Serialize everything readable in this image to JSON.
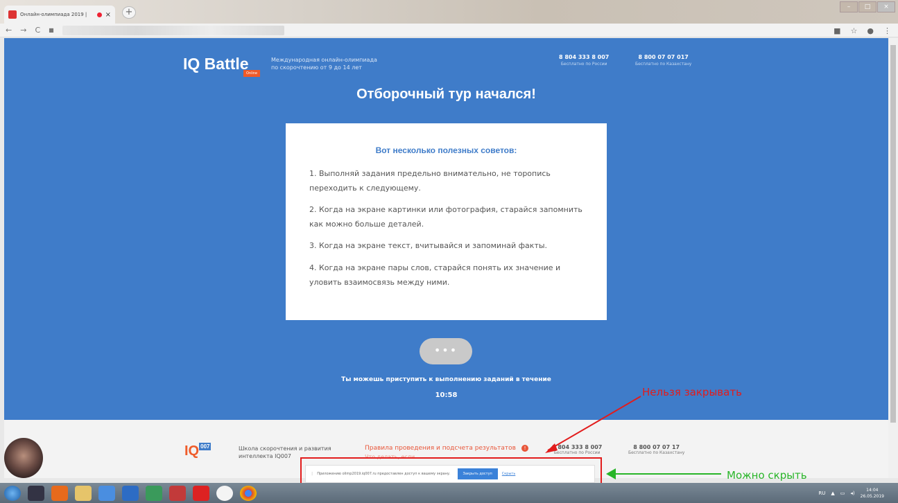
{
  "browser": {
    "tab_title": "Онлайн-олимпиада 2019 |",
    "new_tab": "+",
    "tab_close": "×",
    "back": "←",
    "forward": "→",
    "reload": "C",
    "lock": "🔒"
  },
  "header": {
    "logo": "IQ Battle",
    "logo_badge": "Online",
    "tagline_line1": "Международная онлайн-олимпиада",
    "tagline_line2": "по скорочтению от 9 до 14 лет",
    "phone1": "8 804 333 8 007",
    "phone1_sub": "Бесплатно по России",
    "phone2": "8 800 07 07 017",
    "phone2_sub": "Бесплатно по Казахстану"
  },
  "headline": "Отборочный тур начался!",
  "card": {
    "title": "Вот несколько полезных советов:",
    "tips": [
      "1. Выполняй задания предельно внимательно, не торопись переходить к следующему.",
      "2. Когда на экране картинки или фотография, старайся запомнить как можно больше деталей.",
      "3. Когда на экране текст, вчитывайся и запоминай факты.",
      "4. Когда на экране пары слов, старайся понять их значение и уловить взаимосвязь между ними."
    ]
  },
  "dots_button": "•••",
  "timer_text": "Ты можешь приступить к выполнению заданий в течение",
  "timer": "10:58",
  "footer": {
    "logo": "IQ",
    "logo_badge": "007",
    "school_line1": "Школа скорочтения и развития",
    "school_line2": "интеллекта IQ007",
    "rules": "Правила проведения и подсчета результатов",
    "what_to_do": "Что делать, если",
    "phone1": "8 804 333 8 007",
    "phone1_sub": "Бесплатно по России",
    "phone2": "8 800 07 07 17",
    "phone2_sub": "Бесплатно по Казахстану"
  },
  "sharebar": {
    "text": "Приложению olimp2019.iq007.ru предоставлен доступ к вашему экрану.",
    "stop_button": "Закрыть доступ",
    "hide_link": "Скрыть"
  },
  "annotations": {
    "no_close": "Нельзя закрывать",
    "can_hide": "Можно скрыть"
  },
  "tray": {
    "lang": "RU",
    "time": "14:04",
    "date": "26.05.2019"
  },
  "colors": {
    "page_bg": "#3f7cc9",
    "accent_orange": "#ef5c2a",
    "annotation_red": "#e21c1c",
    "annotation_green": "#28b528"
  }
}
